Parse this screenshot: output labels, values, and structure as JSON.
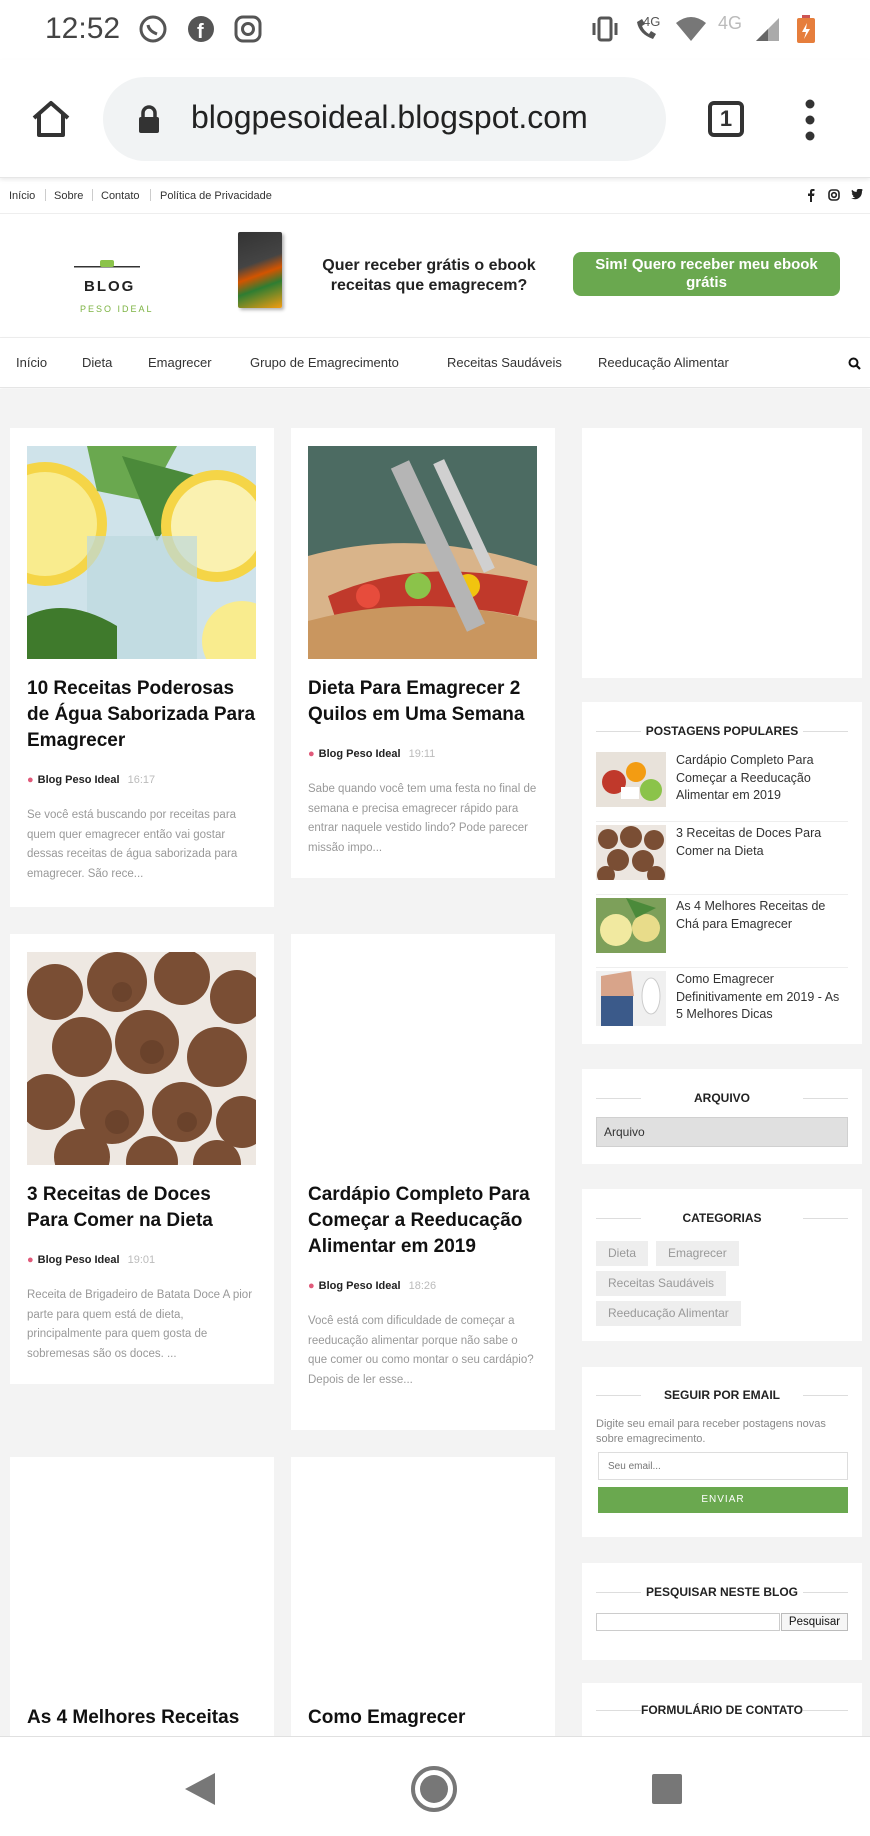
{
  "status_bar": {
    "time": "12:52",
    "left_icons": [
      "whatsapp-icon",
      "facebook-icon",
      "instagram-icon"
    ],
    "right_icons": [
      "vibrate-icon",
      "wifi-call-icon",
      "wifi-icon",
      "signal-icon",
      "battery-icon"
    ],
    "call_network": "4G",
    "network": "4G"
  },
  "browser": {
    "url": "blogpesoideal.blogspot.com",
    "tab_count": "1"
  },
  "top_links": [
    "Início",
    "Sobre",
    "Contato",
    "Política de Privacidade"
  ],
  "social_icons": [
    "facebook-icon",
    "instagram-icon",
    "twitter-icon"
  ],
  "header": {
    "logo_title": "BLOG",
    "logo_subtitle": "PESO IDEAL",
    "ebook_question": "Quer receber grátis o ebook receitas que emagrecem?",
    "ebook_button": "Sim! Quero receber meu ebook grátis"
  },
  "nav": [
    "Início",
    "Dieta",
    "Emagrecer",
    "Grupo de Emagrecimento",
    "Receitas Saudáveis",
    "Reeducação Alimentar"
  ],
  "posts": [
    {
      "title": "10 Receitas Poderosas de Água Saborizada Para Emagrecer",
      "author": "Blog Peso Ideal",
      "time": "16:17",
      "excerpt": "Se você está buscando por receitas para quem quer emagrecer então vai gostar dessas receitas de água saborizada para emagrecer. São rece..."
    },
    {
      "title": "Dieta Para Emagrecer 2 Quilos em Uma Semana",
      "author": "Blog Peso Ideal",
      "time": "19:11",
      "excerpt": "Sabe quando você tem uma festa no final de semana e precisa emagrecer rápido para entrar naquele vestido lindo? Pode parecer missão impo..."
    },
    {
      "title": "3 Receitas de Doces Para Comer na Dieta",
      "author": "Blog Peso Ideal",
      "time": "19:01",
      "excerpt": "Receita de Brigadeiro de Batata Doce A pior parte para quem está de dieta, principalmente para quem gosta de sobremesas são os doces. ..."
    },
    {
      "title": "Cardápio Completo Para Começar a Reeducação Alimentar em 2019",
      "author": "Blog Peso Ideal",
      "time": "18:26",
      "excerpt": "Você está com dificuldade de começar a reeducação alimentar porque não sabe o que comer ou como montar o seu cardápio? Depois de ler esse..."
    },
    {
      "title": "As 4 Melhores Receitas"
    },
    {
      "title": "Como Emagrecer"
    }
  ],
  "sidebar": {
    "popular_title": "POSTAGENS POPULARES",
    "popular": [
      "Cardápio Completo Para Começar a Reeducação Alimentar em 2019",
      "3 Receitas de Doces Para Comer na Dieta",
      "As 4 Melhores Receitas de Chá para Emagrecer",
      "Como Emagrecer Definitivamente em 2019 - As 5 Melhores Dicas"
    ],
    "archive_title": "ARQUIVO",
    "archive_select": "Arquivo",
    "categories_title": "CATEGORIAS",
    "categories": [
      "Dieta",
      "Emagrecer",
      "Receitas Saudáveis",
      "Reeducação Alimentar"
    ],
    "email_title": "SEGUIR POR EMAIL",
    "email_desc": "Digite seu email para receber postagens novas sobre emagrecimento.",
    "email_placeholder": "Seu email...",
    "email_button": "ENVIAR",
    "search_title": "PESQUISAR NESTE BLOG",
    "search_button": "Pesquisar",
    "contact_title": "FORMULÁRIO DE CONTATO"
  },
  "colors": {
    "accent_green": "#6aa84f",
    "author_pink": "#e05a7a",
    "content_bg": "#f3f3f3"
  }
}
